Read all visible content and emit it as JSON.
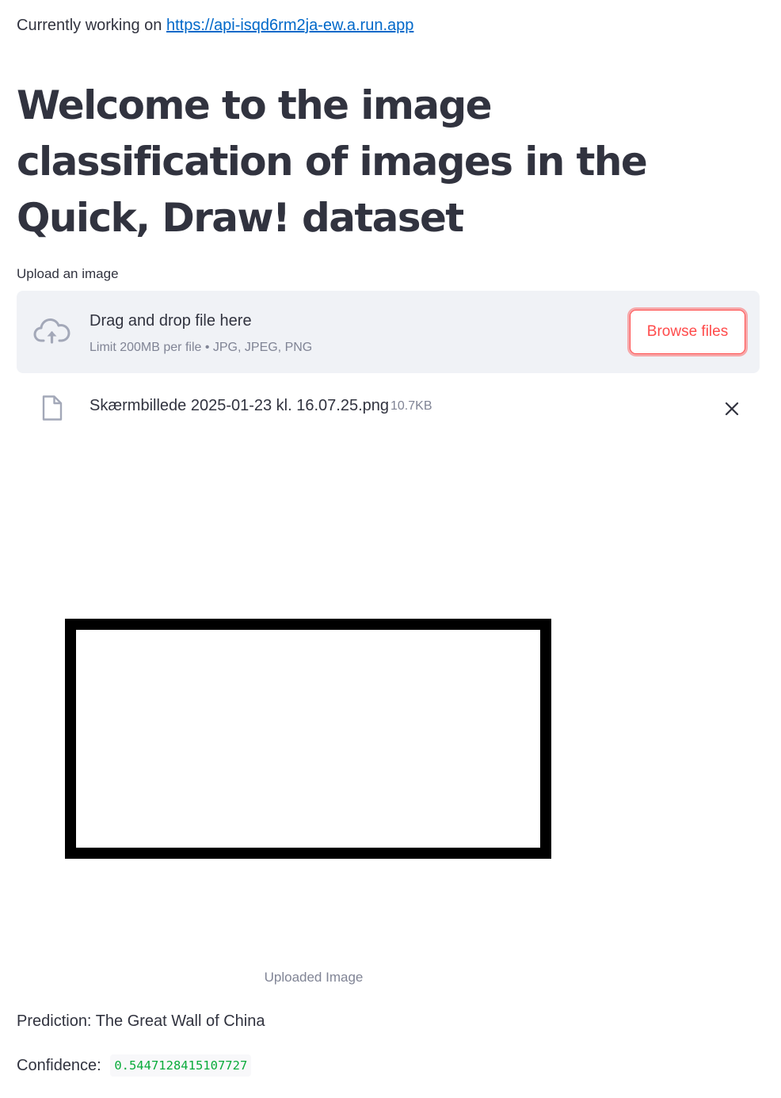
{
  "status": {
    "prefix": "Currently working on",
    "api_url": "https://api-isqd6rm2ja-ew.a.run.app"
  },
  "page_title": "Welcome to the image classification of images in the Quick, Draw! dataset",
  "uploader": {
    "label": "Upload an image",
    "drop_title": "Drag and drop file here",
    "limit_text": "Limit 200MB per file • JPG, JPEG, PNG",
    "browse_label": "Browse files",
    "cloud_icon": "cloud-upload-icon"
  },
  "file": {
    "name": "Skærmbillede 2025-01-23 kl. 16.07.25.png",
    "size": "10.7KB",
    "icon": "file-icon",
    "remove_icon": "close-icon"
  },
  "image": {
    "caption": "Uploaded Image"
  },
  "result": {
    "prediction_text": "Prediction: The Great Wall of China",
    "confidence_label": "Confidence:",
    "confidence_value": "0.5447128415107727"
  },
  "colors": {
    "primary": "#ff4b4b",
    "text": "#31333f",
    "muted": "#808495",
    "link": "#0068c9",
    "code_green": "#09ab3b",
    "dropzone_bg": "#f0f2f6"
  }
}
